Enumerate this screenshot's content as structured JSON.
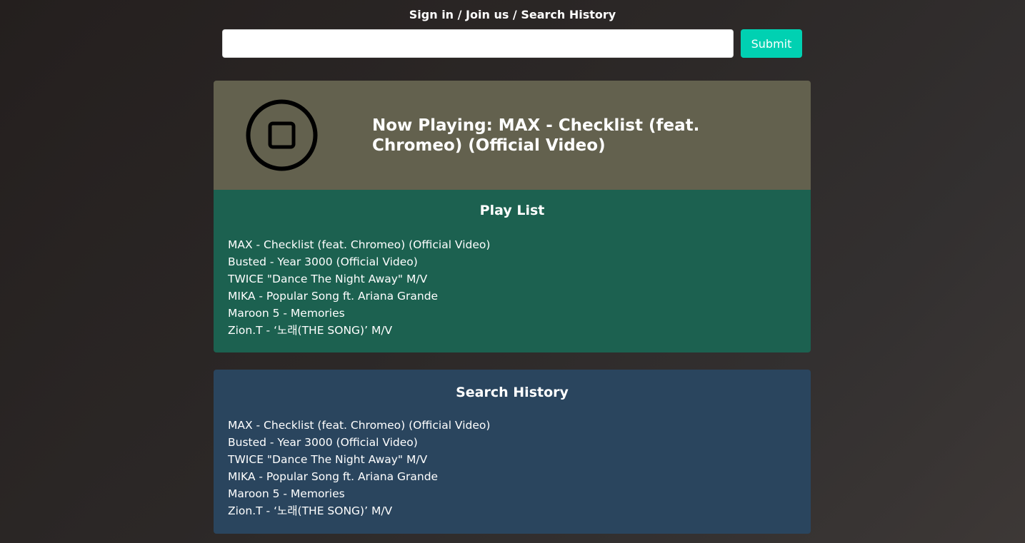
{
  "nav": {
    "sign_in": "Sign in",
    "join_us": "Join us",
    "search_history": "Search History",
    "separator": " / "
  },
  "search": {
    "value": "",
    "placeholder": "",
    "submit_label": "Submit"
  },
  "now_playing": {
    "icon": "stop-circle-icon",
    "title": "Now Playing: MAX - Checklist (feat. Chromeo) (Official Video)"
  },
  "playlist": {
    "title": "Play List",
    "items": [
      "MAX - Checklist (feat. Chromeo) (Official Video)",
      "Busted - Year 3000 (Official Video)",
      "TWICE \"Dance The Night Away\" M/V",
      "MIKA - Popular Song ft. Ariana Grande",
      "Maroon 5 - Memories",
      "Zion.T - ‘노래(THE SONG)’ M/V"
    ]
  },
  "history": {
    "title": "Search History",
    "items": [
      "MAX - Checklist (feat. Chromeo) (Official Video)",
      "Busted - Year 3000 (Official Video)",
      "TWICE \"Dance The Night Away\" M/V",
      "MIKA - Popular Song ft. Ariana Grande",
      "Maroon 5 - Memories",
      "Zion.T - ‘노래(THE SONG)’ M/V"
    ]
  },
  "colors": {
    "accent": "#00d1b2",
    "now_playing_bg": "#63614e",
    "playlist_bg": "#1c6150",
    "history_bg": "#2a455e"
  }
}
